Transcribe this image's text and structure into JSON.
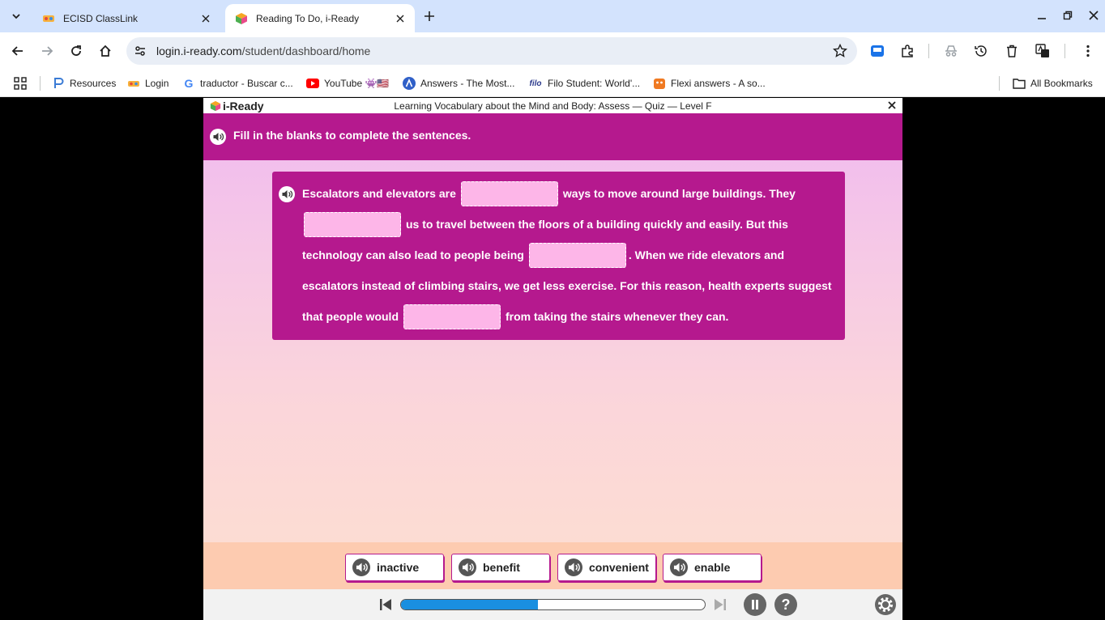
{
  "browser": {
    "tabs": [
      {
        "title": "ECISD ClassLink",
        "active": false
      },
      {
        "title": "Reading To Do, i-Ready",
        "active": true
      }
    ],
    "url": {
      "host": "login.i-ready.com",
      "path": "/student/dashboard/home"
    },
    "bookmarks": [
      {
        "label": "Resources",
        "icon": "p-logo-icon"
      },
      {
        "label": "Login",
        "icon": "classlink-icon"
      },
      {
        "label": "traductor - Buscar c...",
        "icon": "google-icon"
      },
      {
        "label": "YouTube 👾🇺🇸",
        "icon": "youtube-icon"
      },
      {
        "label": "Answers - The Most...",
        "icon": "answers-icon"
      },
      {
        "label": "Filo Student: World'...",
        "icon": "filo-icon"
      },
      {
        "label": "Flexi answers - A so...",
        "icon": "flexi-icon"
      }
    ],
    "all_bookmarks": "All Bookmarks"
  },
  "app": {
    "logo": "i-Ready",
    "quiz_title": "Learning Vocabulary about the Mind and Body: Assess — Quiz — Level F",
    "instruction": "Fill in the blanks to complete the sentences.",
    "passage": {
      "line1_a": "Escalators and elevators are",
      "line1_b": "ways to move around large buildings. They",
      "line2_b": "us to travel between the floors of a building quickly and easily. But this",
      "line3_a": "technology can also lead to people being",
      "line3_b": ". When we ride elevators and",
      "line4": "escalators instead of climbing stairs, we get less exercise. For this reason, health experts suggest",
      "line5_a": "that people would",
      "line5_b": "from taking the stairs whenever they can."
    },
    "choices": [
      "inactive",
      "benefit",
      "convenient",
      "enable"
    ],
    "progress": 0.45,
    "help_symbol": "?"
  },
  "colors": {
    "accent": "#b5198e",
    "blank": "#fdb6e8",
    "progress": "#1a8fe0"
  }
}
